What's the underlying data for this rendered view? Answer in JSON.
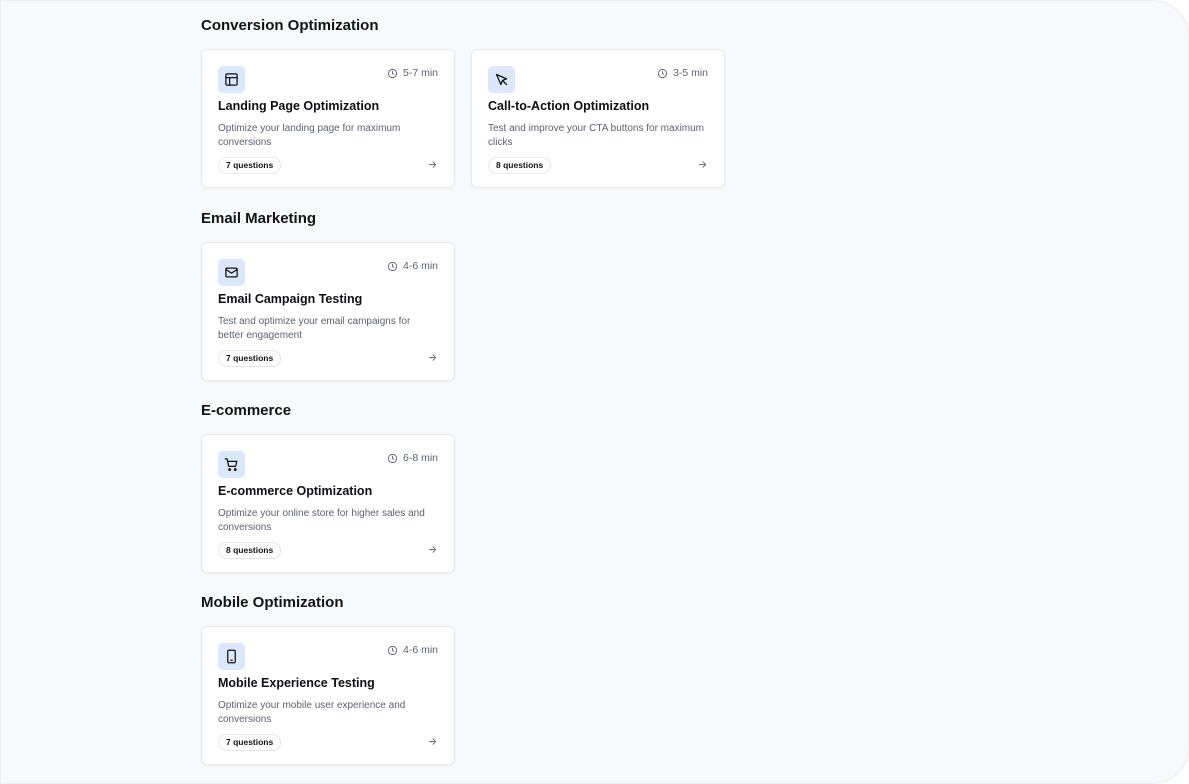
{
  "sections": [
    {
      "title": "Conversion Optimization",
      "cards": [
        {
          "title": "Landing Page Optimization",
          "description": "Optimize your landing page for maximum conversions",
          "duration": "5-7 min",
          "questions": "7 questions",
          "icon": "layout-icon"
        },
        {
          "title": "Call-to-Action Optimization",
          "description": "Test and improve your CTA buttons for maximum clicks",
          "duration": "3-5 min",
          "questions": "8 questions",
          "icon": "cursor-icon"
        }
      ]
    },
    {
      "title": "Email Marketing",
      "cards": [
        {
          "title": "Email Campaign Testing",
          "description": "Test and optimize your email campaigns for better engagement",
          "duration": "4-6 min",
          "questions": "7 questions",
          "icon": "mail-icon"
        }
      ]
    },
    {
      "title": "E-commerce",
      "cards": [
        {
          "title": "E-commerce Optimization",
          "description": "Optimize your online store for higher sales and conversions",
          "duration": "6-8 min",
          "questions": "8 questions",
          "icon": "cart-icon"
        }
      ]
    },
    {
      "title": "Mobile Optimization",
      "cards": [
        {
          "title": "Mobile Experience Testing",
          "description": "Optimize your mobile user experience and conversions",
          "duration": "4-6 min",
          "questions": "7 questions",
          "icon": "smartphone-icon"
        }
      ]
    }
  ],
  "colors": {
    "icon_bg": "#dbe7fb",
    "page_bg": "#f8f9fb"
  }
}
